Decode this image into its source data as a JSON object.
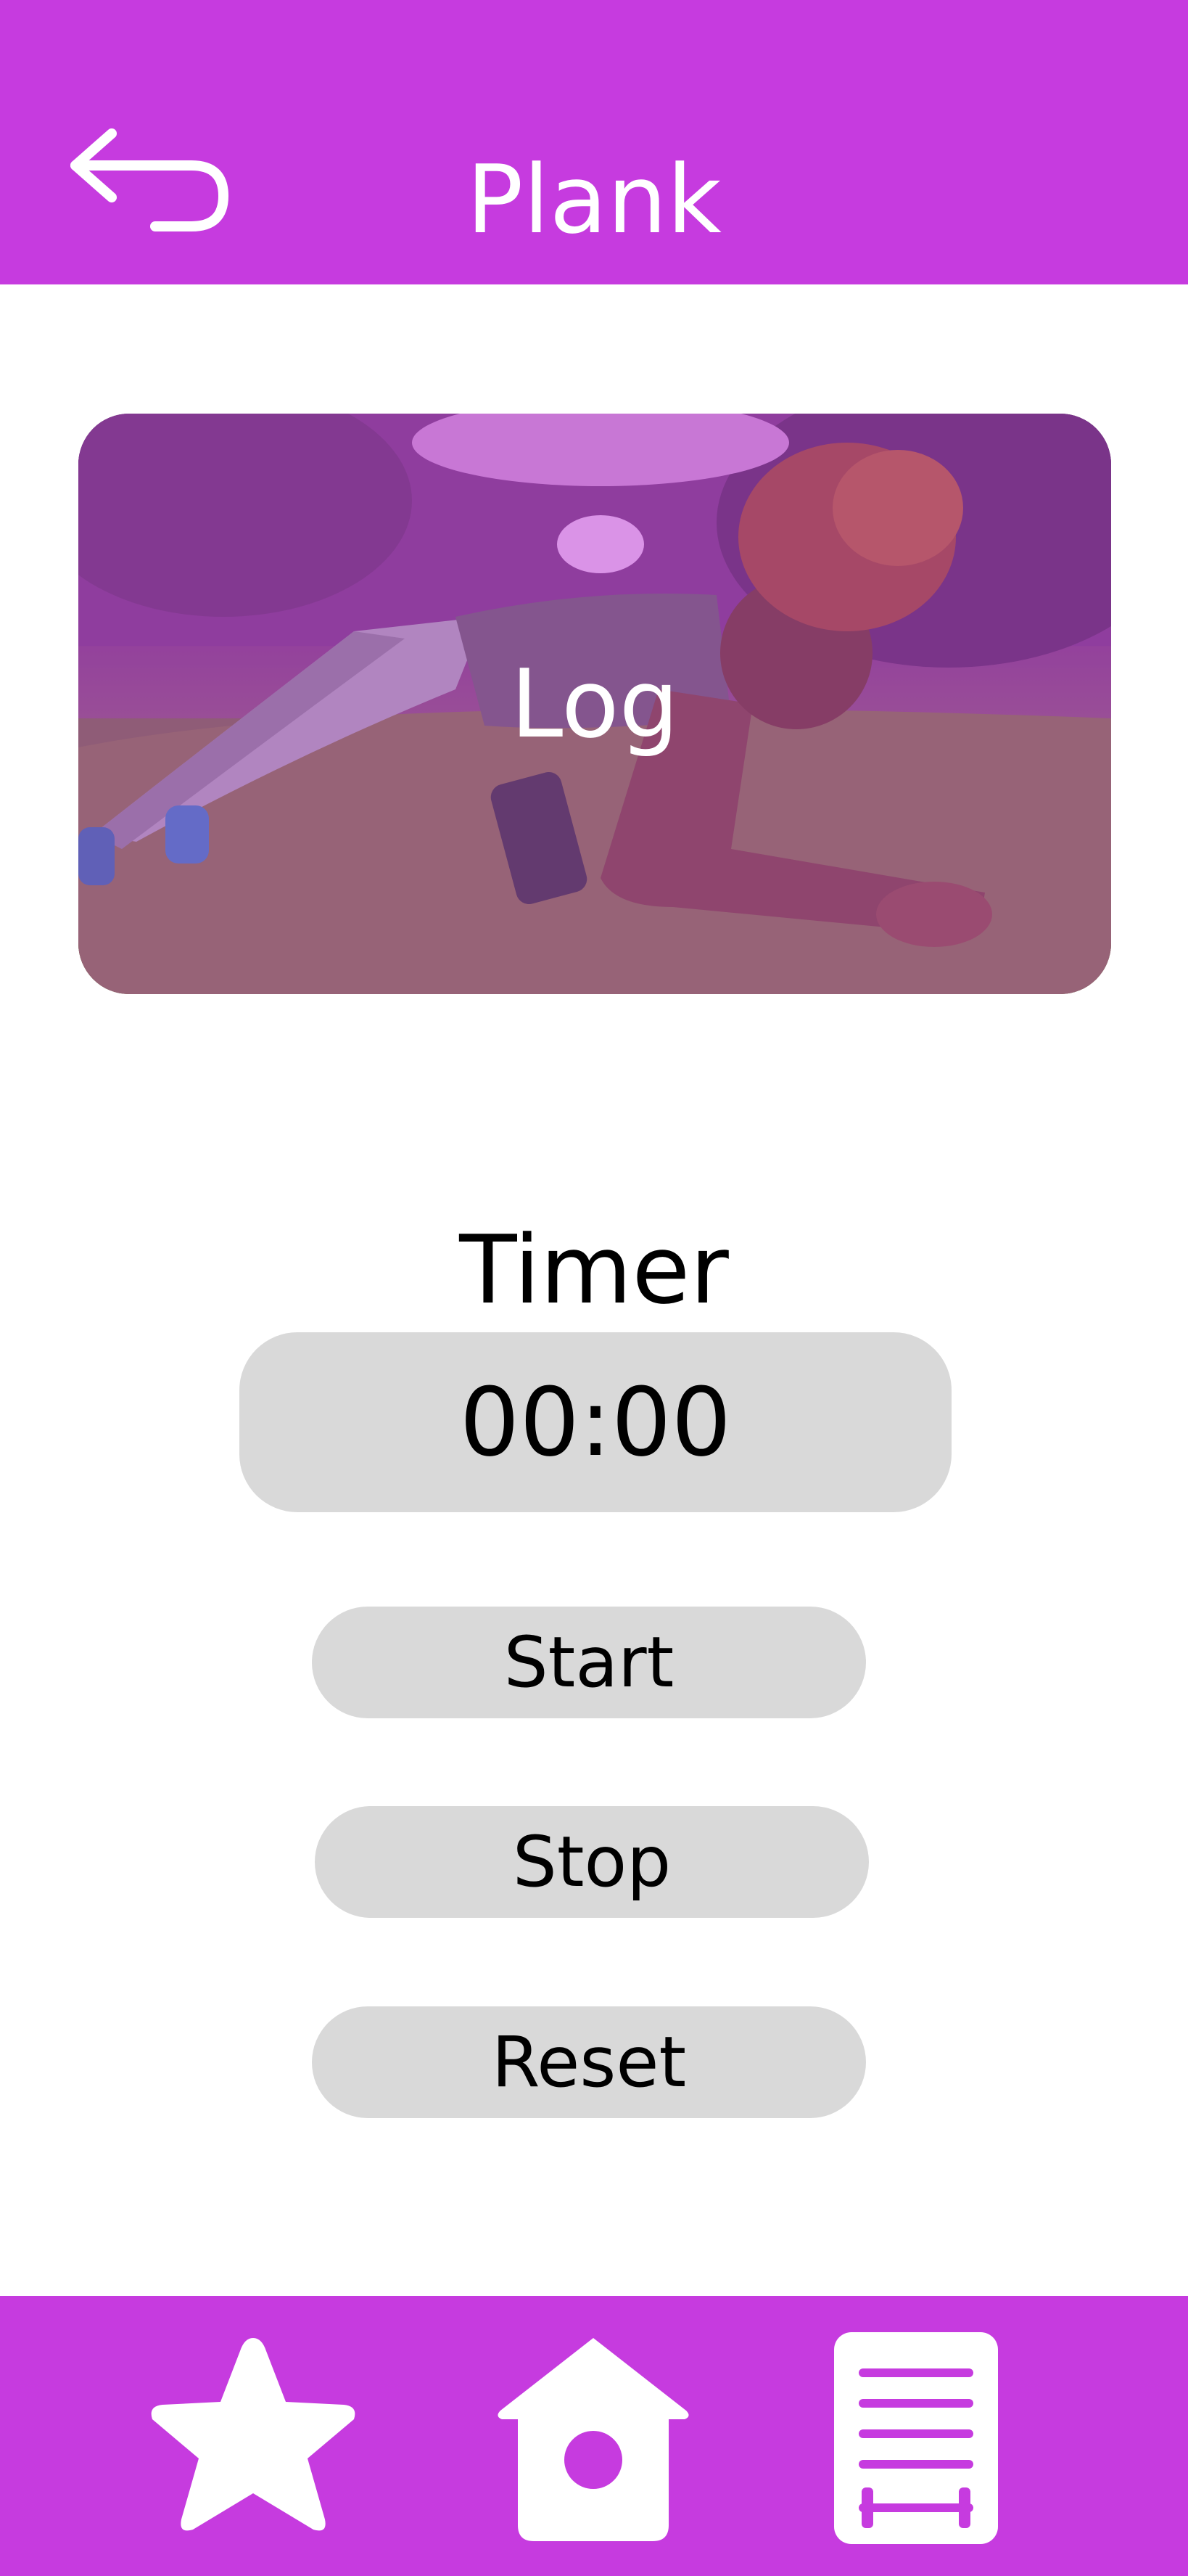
{
  "header": {
    "title": "Plank",
    "back_icon": "back-arrow-icon"
  },
  "log_card": {
    "label": "Log",
    "image": "woman-doing-plank-photo"
  },
  "timer": {
    "label": "Timer",
    "value": "00:00"
  },
  "controls": {
    "start_label": "Start",
    "stop_label": "Stop",
    "reset_label": "Reset"
  },
  "nav": {
    "favorites_icon": "star-icon",
    "home_icon": "home-icon",
    "workout_log_icon": "workout-log-icon"
  },
  "colors": {
    "accent": "#c63bdf",
    "button_bg": "#d9d9d9",
    "background": "#ffffff"
  }
}
